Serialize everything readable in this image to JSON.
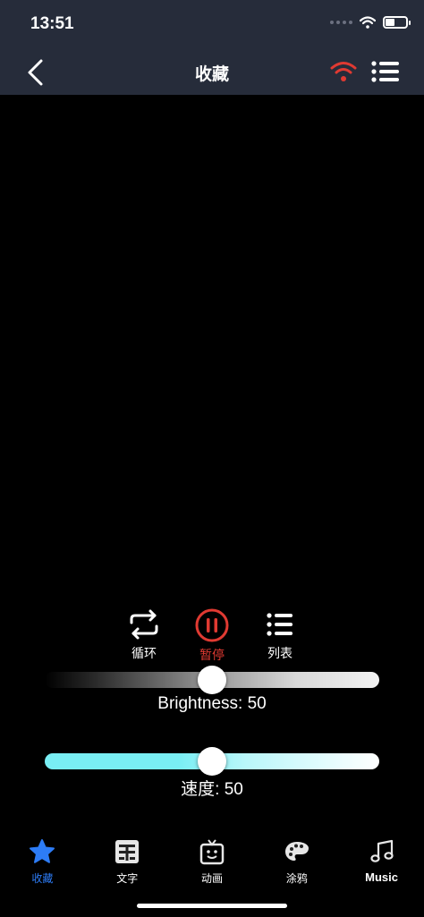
{
  "status_bar": {
    "time": "13:51"
  },
  "nav": {
    "title": "收藏"
  },
  "controls": {
    "loop_label": "循环",
    "pause_label": "暂停",
    "list_label": "列表"
  },
  "sliders": {
    "brightness": {
      "label": "Brightness: 50",
      "value": 50,
      "max": 100
    },
    "speed": {
      "label": "速度: 50",
      "value": 50,
      "max": 100
    }
  },
  "tabs": [
    {
      "label": "收藏",
      "icon": "star-icon",
      "active": true
    },
    {
      "label": "文字",
      "icon": "text-icon",
      "active": false
    },
    {
      "label": "动画",
      "icon": "animation-icon",
      "active": false
    },
    {
      "label": "涂鸦",
      "icon": "palette-icon",
      "active": false
    },
    {
      "label": "Music",
      "icon": "music-note-icon",
      "active": false
    }
  ],
  "colors": {
    "header_bg": "#262c3a",
    "accent_red": "#e03a32",
    "active_blue": "#2d7cf6",
    "speed_track": "#79eef4"
  }
}
